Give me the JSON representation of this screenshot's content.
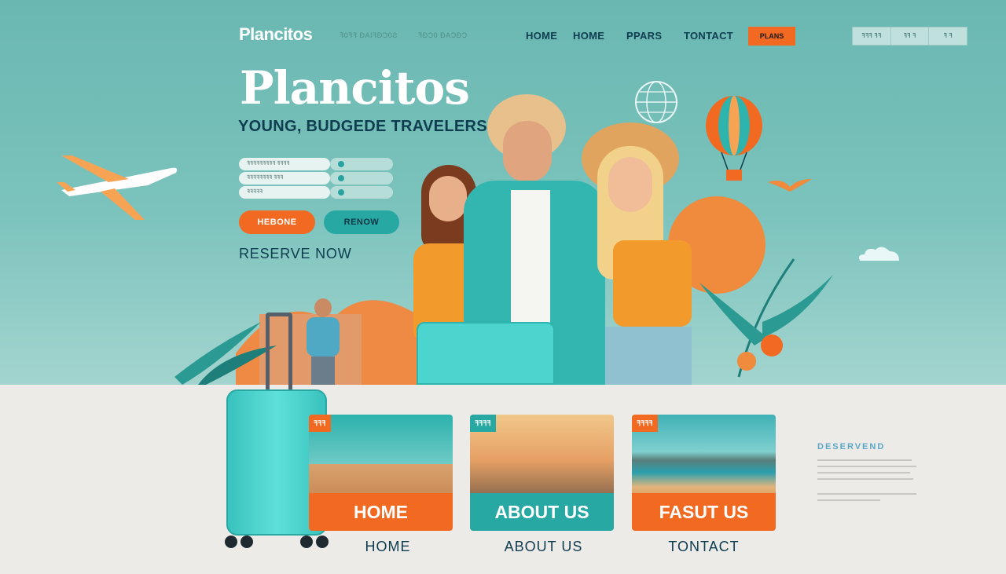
{
  "brand": "Plancitos",
  "nav": {
    "faint_1": "ꟻ0ꟻꟻ ƉAIꟻƉƆ0Ƨ",
    "faint_2": "ꟻƉƆ0   ƉAƆƉƆ",
    "links": [
      "HOME",
      "HOME",
      "PPARS",
      "TONTACT"
    ],
    "cta": "PLANS",
    "utility": [
      "ꟻꟻꟻ ꟻꟻ",
      "ꟻꟻ ꟻ",
      "ꟻ ꟻ"
    ]
  },
  "hero": {
    "title": "Plancitos",
    "tagline": "YOUNG, BUDGEDE TRAVELERS",
    "fields": [
      "ꟻꟻꟻꟻꟻꟻꟻꟻꟻ ꟻꟻꟻꟻ",
      "ꟻꟻꟻꟻꟻꟻꟻꟻ ꟻꟻꟻ",
      "ꟻꟻꟻꟻꟻ"
    ],
    "btn_primary": "HEBONE",
    "btn_secondary": "RENOW",
    "reserve": "RESERVE NOW"
  },
  "cards": [
    {
      "tag": "ꟻꟻꟻ",
      "label": "HOME",
      "caption": "HOME"
    },
    {
      "tag": "ꟻꟻꟻꟻ",
      "label": "ABOUT US",
      "caption": "ABOUT US"
    },
    {
      "tag": "ꟻꟻꟻꟻ",
      "label": "FASUT US",
      "caption": "TONTACT"
    }
  ],
  "side": {
    "label": "DESERVEND"
  },
  "colors": {
    "teal": "#27a8a3",
    "orange": "#f26a21",
    "navy": "#0f3d50",
    "bg_teal": "#6ab7b1"
  },
  "icons": [
    "airplane-icon",
    "globe-icon",
    "hot-air-balloon-icon",
    "suitcase-icon",
    "cloud-icon",
    "bird-icon"
  ]
}
